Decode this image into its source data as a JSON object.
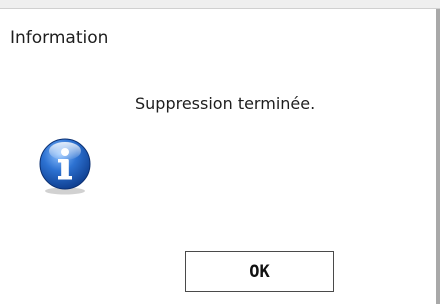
{
  "dialog": {
    "title": "Information",
    "message": "Suppression terminée.",
    "icon": "information-icon",
    "ok_label": "OK"
  },
  "colors": {
    "icon_blue": "#1f5fb8",
    "button_border": "#4a4a4a",
    "text": "#1e1e1e"
  }
}
